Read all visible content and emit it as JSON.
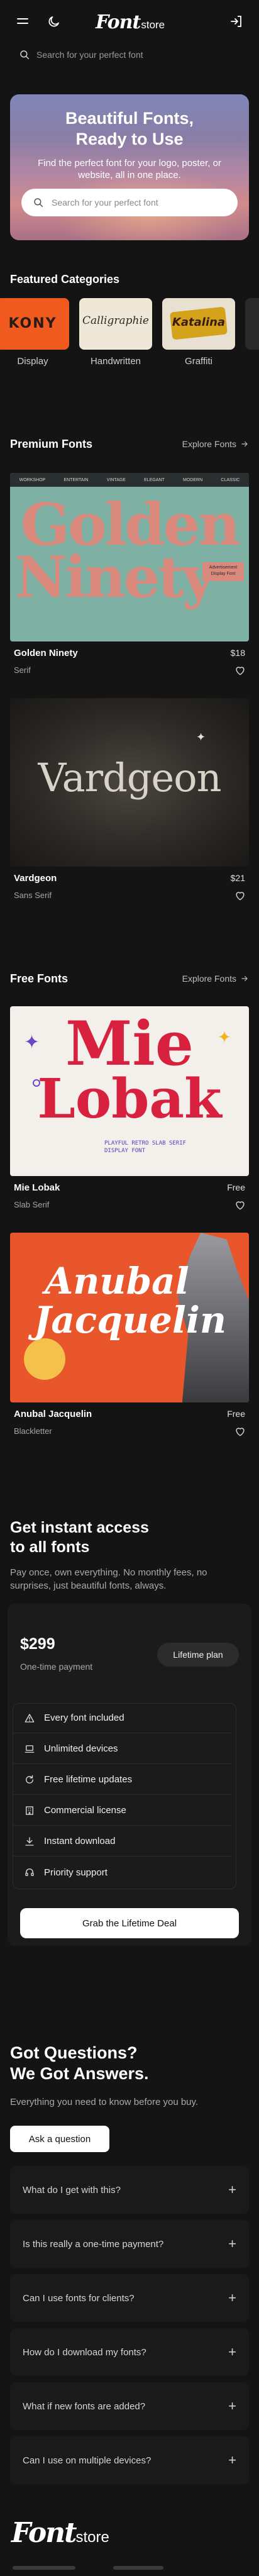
{
  "header": {
    "logo_word": "Font",
    "logo_sub": "store",
    "search_placeholder": "Search for your perfect font"
  },
  "hero": {
    "title_line1": "Beautiful Fonts,",
    "title_line2": "Ready to Use",
    "subtitle": "Find the perfect font for your logo, poster, or website, all in one place.",
    "search_placeholder": "Search for your perfect font"
  },
  "featured": {
    "title": "Featured Categories",
    "items": [
      {
        "label": "Display",
        "sample": "KONY"
      },
      {
        "label": "Handwritten",
        "sample": "Calligraphie"
      },
      {
        "label": "Graffiti",
        "sample": "Katalina"
      }
    ]
  },
  "premium": {
    "title": "Premium Fonts",
    "explore": "Explore Fonts",
    "fonts": [
      {
        "name": "Golden Ninety",
        "category": "Serif",
        "price": "$18",
        "specimen_line1": "Golden",
        "specimen_line2": "Ninety",
        "tags": [
          "WORKSHOP",
          "ENTERTAIN",
          "VINTAGE",
          "ELEGANT",
          "MODERN",
          "CLASSIC"
        ],
        "badge": "Advertisement Display Font"
      },
      {
        "name": "Vardgeon",
        "category": "Sans Serif",
        "price": "$21",
        "specimen": "Vardgeon"
      }
    ]
  },
  "free": {
    "title": "Free Fonts",
    "explore": "Explore Fonts",
    "fonts": [
      {
        "name": "Mie Lobak",
        "category": "Slab Serif",
        "price": "Free",
        "specimen_line1": "Mie",
        "specimen_line2": "Lobak",
        "note": "PLAYFUL RETRO SLAB SERIF DISPLAY FONT"
      },
      {
        "name": "Anubal Jacquelin",
        "category": "Blackletter",
        "price": "Free",
        "specimen_line1": "Anubal",
        "specimen_line2": "Jacquelin"
      }
    ]
  },
  "access": {
    "title_line1": "Get instant access",
    "title_line2": "to all fonts",
    "subtitle": "Pay once, own everything. No monthly fees, no surprises, just beautiful fonts, always.",
    "price": "$299",
    "price_note": "One-time payment",
    "plan_badge": "Lifetime plan",
    "features": [
      "Every font included",
      "Unlimited devices",
      "Free lifetime updates",
      "Commercial license",
      "Instant download",
      "Priority support"
    ],
    "cta": "Grab the Lifetime Deal"
  },
  "faq": {
    "title_line1": "Got Questions?",
    "title_line2": "We Got Answers.",
    "subtitle": "Everything you need to know before you buy.",
    "ask_button": "Ask a question",
    "items": [
      "What do I get with this?",
      "Is this really a one-time payment?",
      "Can I use fonts for clients?",
      "How do I download my fonts?",
      "What if new fonts are added?",
      "Can I use on multiple devices?"
    ]
  },
  "footer": {
    "logo_word": "Font",
    "logo_sub": "store"
  },
  "colors": {
    "background": "#141414",
    "card": "#1b1b1b",
    "golden_ninety_bg": "#7fb0a4",
    "golden_ninety_text": "#d98a7c",
    "mie_lobak_red": "#d8213f",
    "anubal_orange": "#e9562b"
  }
}
